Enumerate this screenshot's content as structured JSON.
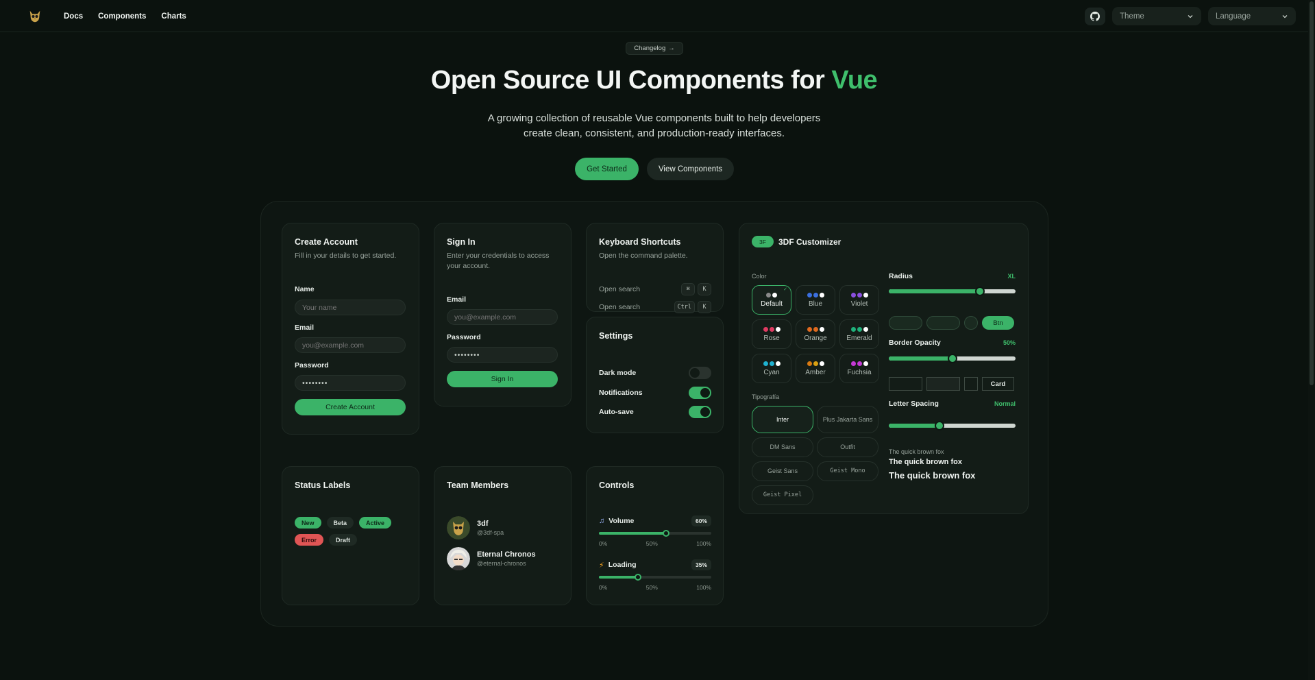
{
  "nav": {
    "items": [
      "Docs",
      "Components",
      "Charts"
    ],
    "theme_label": "Theme",
    "language_label": "Language"
  },
  "hero": {
    "changelog": "Changelog",
    "title_main": "Open Source UI Components for ",
    "title_accent": "Vue",
    "subtitle_line1": "A growing collection of reusable Vue components built to help developers",
    "subtitle_line2": "create clean, consistent, and production-ready interfaces.",
    "primary_btn": "Get Started",
    "secondary_btn": "View Components"
  },
  "create_account": {
    "title": "Create Account",
    "desc": "Fill in your details to get started.",
    "name_label": "Name",
    "name_placeholder": "Your name",
    "email_label": "Email",
    "email_placeholder": "you@example.com",
    "password_label": "Password",
    "password_value": "••••••••",
    "submit": "Create Account"
  },
  "sign_in": {
    "title": "Sign In",
    "desc_line1": "Enter your credentials to access",
    "desc_line2": "your account.",
    "email_label": "Email",
    "email_placeholder": "you@example.com",
    "password_label": "Password",
    "password_value": "••••••••",
    "submit": "Sign In"
  },
  "shortcuts": {
    "title": "Keyboard Shortcuts",
    "desc": "Open the command palette.",
    "rows": [
      {
        "label": "Open search",
        "keys": [
          "⌘",
          "K"
        ]
      },
      {
        "label": "Open search",
        "keys": [
          "Ctrl",
          "K"
        ]
      }
    ]
  },
  "settings": {
    "title": "Settings",
    "rows": [
      {
        "label": "Dark mode",
        "on": false
      },
      {
        "label": "Notifications",
        "on": true
      },
      {
        "label": "Auto-save",
        "on": true
      }
    ]
  },
  "status": {
    "title": "Status Labels",
    "badges": [
      "New",
      "Beta",
      "Active",
      "Error",
      "Draft"
    ]
  },
  "team": {
    "title": "Team Members",
    "members": [
      {
        "name": "3df",
        "handle": "@3df-spa"
      },
      {
        "name": "Eternal Chronos",
        "handle": "@eternal-chronos"
      }
    ]
  },
  "controls": {
    "title": "Controls",
    "volume": {
      "label": "Volume",
      "value": 60,
      "display": "60%"
    },
    "loading": {
      "label": "Loading",
      "value": 35,
      "display": "35%"
    },
    "scale": [
      "0%",
      "50%",
      "100%"
    ]
  },
  "customizer": {
    "badge": "3F",
    "title": "3DF Customizer",
    "color_label": "Color",
    "colors": [
      {
        "name": "Default",
        "dots": [
          "#8a8a8a",
          "#ffffff"
        ],
        "selected": true
      },
      {
        "name": "Blue",
        "dots": [
          "#3b6fe0",
          "#3b6fe0",
          "#ffffff"
        ],
        "selected": false
      },
      {
        "name": "Violet",
        "dots": [
          "#8b4fe0",
          "#8b4fe0",
          "#ffffff"
        ],
        "selected": false
      },
      {
        "name": "Rose",
        "dots": [
          "#e03b62",
          "#e03b62",
          "#ffffff"
        ],
        "selected": false
      },
      {
        "name": "Orange",
        "dots": [
          "#e06a1f",
          "#e06a1f",
          "#ffffff"
        ],
        "selected": false
      },
      {
        "name": "Emerald",
        "dots": [
          "#1fb07a",
          "#1fb07a",
          "#ffffff"
        ],
        "selected": false
      },
      {
        "name": "Cyan",
        "dots": [
          "#1fb2d0",
          "#1fb2d0",
          "#ffffff"
        ],
        "selected": false
      },
      {
        "name": "Amber",
        "dots": [
          "#d97a12",
          "#d9a012",
          "#ffffff"
        ],
        "selected": false
      },
      {
        "name": "Fuchsia",
        "dots": [
          "#c53ad6",
          "#c53ad6",
          "#ffffff"
        ],
        "selected": false
      }
    ],
    "font_label": "Tipografía",
    "fonts": [
      "Inter",
      "Plus Jakarta Sans",
      "DM Sans",
      "Outfit",
      "Geist Sans",
      "Geist Mono",
      "Geist Pixel"
    ],
    "radius": {
      "label": "Radius",
      "value_text": "XL",
      "level": 0.72
    },
    "preview_btn": "Btn",
    "border_opacity": {
      "label": "Border Opacity",
      "value_text": "50%",
      "level": 0.5
    },
    "preview_card": "Card",
    "letter_spacing": {
      "label": "Letter Spacing",
      "value_text": "Normal",
      "level": 0.4
    },
    "fox_samples": [
      "The quick brown fox",
      "The quick brown fox",
      "The quick brown fox"
    ]
  },
  "colors": {
    "accent": "#3bb368",
    "background": "#0b120e",
    "error": "#e05555"
  }
}
